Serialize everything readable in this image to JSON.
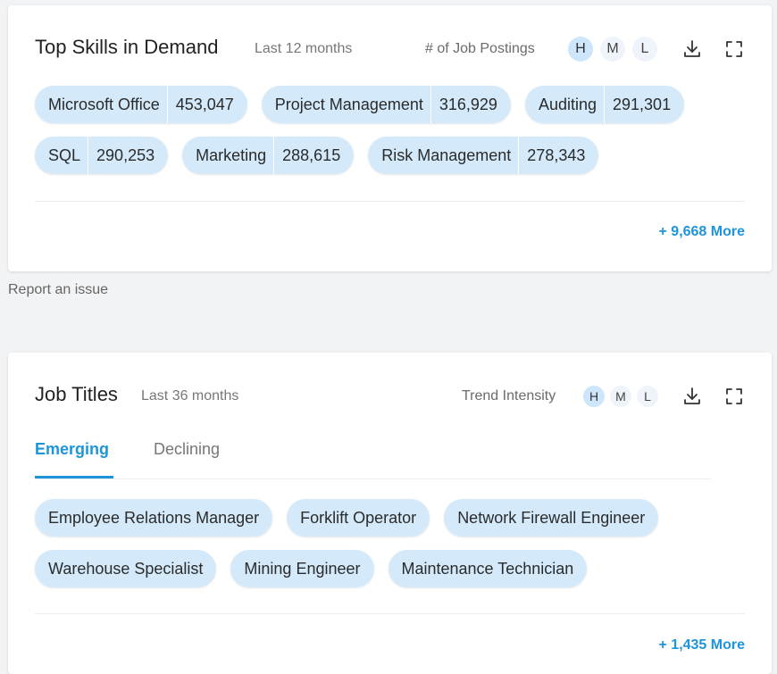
{
  "skills_card": {
    "title": "Top Skills in Demand",
    "period": "Last 12 months",
    "metric_label": "# of Job Postings",
    "levels": [
      "H",
      "M",
      "L"
    ],
    "active_level": "H",
    "icons": [
      "download-icon",
      "fullscreen-icon"
    ],
    "skills": [
      {
        "name": "Microsoft Office",
        "count": "453,047"
      },
      {
        "name": "Project Management",
        "count": "316,929"
      },
      {
        "name": "Auditing",
        "count": "291,301"
      },
      {
        "name": "SQL",
        "count": "290,253"
      },
      {
        "name": "Marketing",
        "count": "288,615"
      },
      {
        "name": "Risk Management",
        "count": "278,343"
      }
    ],
    "more_label": "+ 9,668 More"
  },
  "report_issue": "Report an issue",
  "titles_card": {
    "title": "Job Titles",
    "period": "Last 36 months",
    "metric_label": "Trend Intensity",
    "levels": [
      "H",
      "M",
      "L"
    ],
    "active_level": "H",
    "icons": [
      "download-icon",
      "fullscreen-icon"
    ],
    "tabs": [
      {
        "label": "Emerging",
        "active": true
      },
      {
        "label": "Declining",
        "active": false
      }
    ],
    "titles": [
      "Employee Relations Manager",
      "Forklift Operator",
      "Network Firewall Engineer",
      "Warehouse Specialist",
      "Mining Engineer",
      "Maintenance Technician"
    ],
    "more_label": "+ 1,435 More"
  },
  "colors": {
    "accent": "#1e95d9",
    "chip_bg": "#d4eafb",
    "level_active_bg": "#cde6fb"
  }
}
